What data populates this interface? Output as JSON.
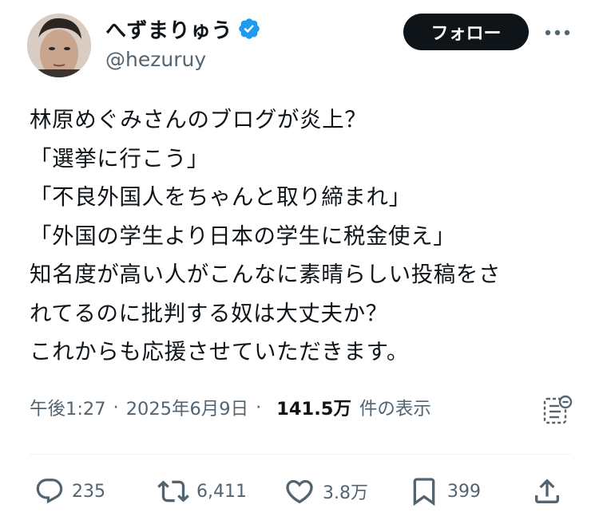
{
  "author": {
    "display_name": "へずまりゅう",
    "handle": "@hezuruy",
    "verified": true
  },
  "header": {
    "follow_label": "フォロー"
  },
  "tweet": {
    "lines": [
      "林原めぐみさんのブログが炎上？",
      "「選挙に行こう」",
      "「不良外国人をちゃんと取り締まれ」",
      "「外国の学生より日本の学生に税金使え」",
      "知名度が高い人がこんなに素晴らしい投稿をさ",
      "れてるのに批判する奴は大丈夫か？",
      "これからも応援させていただきます。"
    ]
  },
  "meta": {
    "time": "午後1:27",
    "separator": "·",
    "date": "2025年6月9日",
    "views_count": "141.5万",
    "views_label": "件の表示"
  },
  "actions": {
    "replies": "235",
    "reposts": "6,411",
    "likes": "3.8万",
    "bookmarks": "399"
  },
  "colors": {
    "text": "#0f1419",
    "secondary": "#536471",
    "verified_blue": "#1d9bf0",
    "button_bg": "#0f1419",
    "divider": "#eff3f4"
  },
  "icons": {
    "verified": "verified-badge-icon",
    "more": "more-dots-icon",
    "analytics": "analytics-icon",
    "reply": "reply-icon",
    "repost": "repost-icon",
    "like": "heart-icon",
    "bookmark": "bookmark-icon",
    "share": "share-icon"
  }
}
